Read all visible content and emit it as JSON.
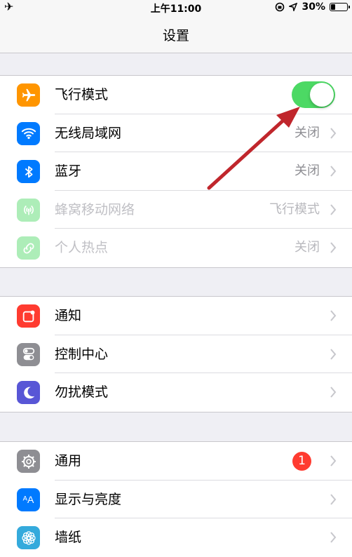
{
  "status_bar": {
    "time": "上午11:00",
    "battery_text": "30%",
    "battery_level": 0.3,
    "airplane_icon": "airplane-icon",
    "lock_icon": "rotation-lock-icon",
    "location_icon": "location-arrow-icon"
  },
  "nav": {
    "title": "设置"
  },
  "group1": [
    {
      "label": "飞行模式",
      "icon": "airplane-icon",
      "color": "#ff9500",
      "toggle": true
    },
    {
      "label": "无线局域网",
      "icon": "wifi-icon",
      "color": "#007aff",
      "value": "关闭"
    },
    {
      "label": "蓝牙",
      "icon": "bluetooth-icon",
      "color": "#007aff",
      "value": "关闭"
    },
    {
      "label": "蜂窝移动网络",
      "icon": "cellular-icon",
      "color": "#4cd964",
      "value": "飞行模式",
      "disabled": true
    },
    {
      "label": "个人热点",
      "icon": "hotspot-icon",
      "color": "#4cd964",
      "value": "关闭",
      "disabled": true
    }
  ],
  "group2": [
    {
      "label": "通知",
      "icon": "notifications-icon",
      "color": "#ff3b30"
    },
    {
      "label": "控制中心",
      "icon": "control-center-icon",
      "color": "#8e8e93"
    },
    {
      "label": "勿扰模式",
      "icon": "moon-icon",
      "color": "#5856d6"
    }
  ],
  "group3": [
    {
      "label": "通用",
      "icon": "gear-icon",
      "color": "#8e8e93",
      "badge": "1"
    },
    {
      "label": "显示与亮度",
      "icon": "display-brightness-icon",
      "color": "#007aff"
    },
    {
      "label": "墙纸",
      "icon": "wallpaper-icon",
      "color": "#34aadc"
    }
  ],
  "annotation": {
    "type": "red-arrow",
    "color": "#c0262c",
    "points_to": "飞行模式 toggle"
  }
}
